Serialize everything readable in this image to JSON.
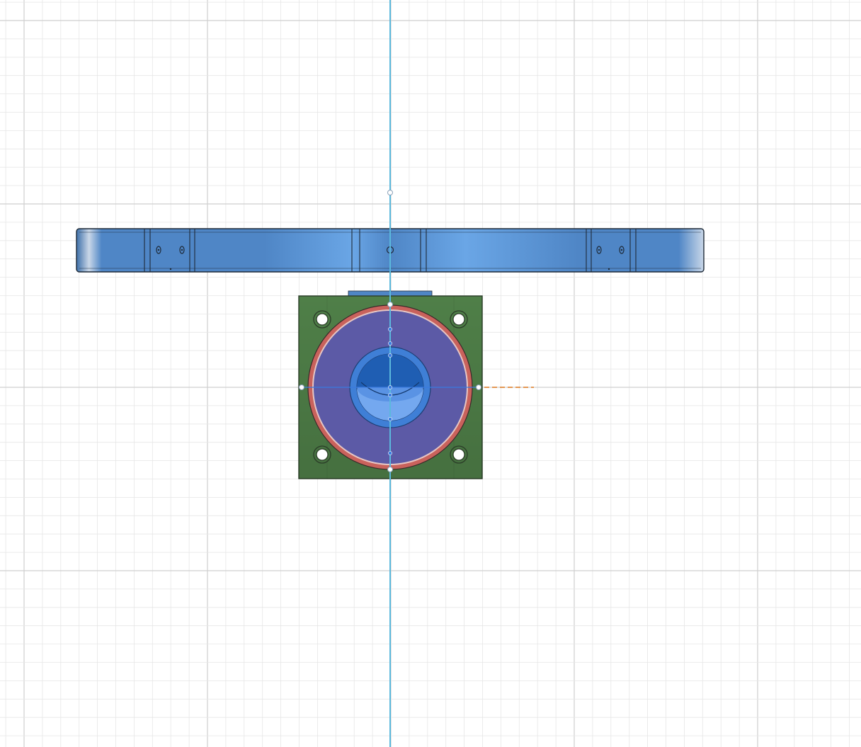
{
  "viewport": {
    "background": "#ffffff",
    "grid": {
      "visible": true,
      "minor_color": "#e6e6e6",
      "major_color": "#cfcfcf"
    }
  },
  "scene": {
    "construction_axis_color": "#5bb8dc",
    "sketch_line_color": "#3a7be0",
    "dimension_hint_color": "#e07a1f",
    "bar_body": {
      "color": "#4f86c6",
      "highlight_color": "#6aa6e6",
      "shadow_color": "#3d6fa8",
      "edge_color": "#1e2a38"
    },
    "motor_mount": {
      "plate_color": "#4f7f48",
      "plate_edge_color": "#2b3d28",
      "ring_color": "#c9625c",
      "face_color": "#5c5aa6",
      "hub_outer_color": "#3f7fd6",
      "hub_inner_color": "#1f5eb3",
      "hub_light_color": "#74a8ef",
      "screw_hole_count": 4
    }
  }
}
